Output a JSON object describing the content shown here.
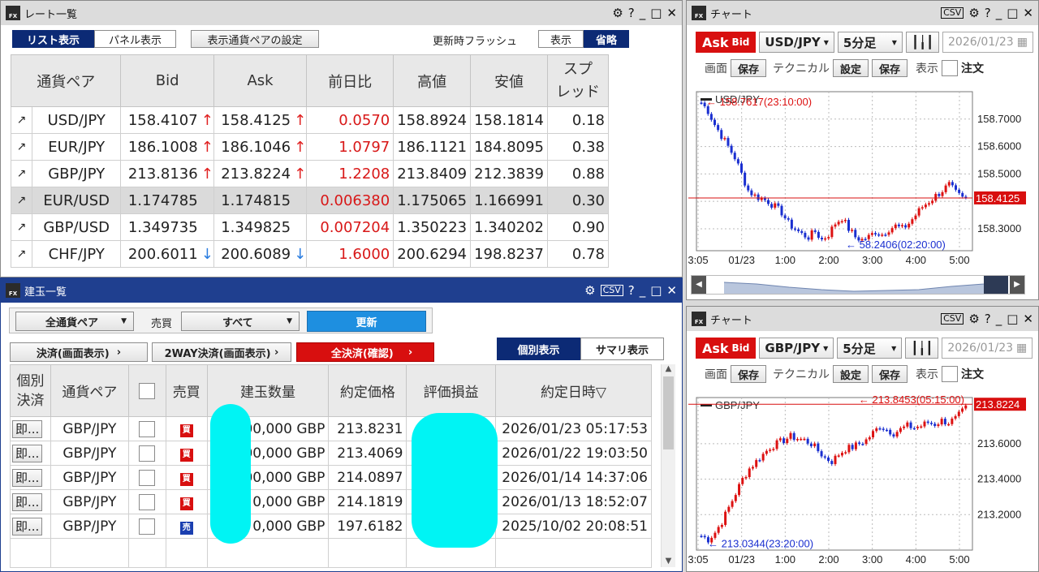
{
  "rate_window": {
    "title": "レート一覧",
    "tab_list": "リスト表示",
    "tab_panel": "パネル表示",
    "pair_settings": "表示通貨ペアの設定",
    "flash_label": "更新時フラッシュ",
    "flash_show": "表示",
    "flash_omit": "省略",
    "headers": {
      "pair": "通貨ペア",
      "bid": "Bid",
      "ask": "Ask",
      "change": "前日比",
      "high": "高値",
      "low": "安値",
      "spread1": "スプ",
      "spread2": "レッド"
    },
    "rows": [
      {
        "pair": "USD/JPY",
        "bid": "158.4107",
        "bid_dir": "up",
        "ask": "158.4125",
        "ask_dir": "up",
        "change": "0.0570",
        "high": "158.8924",
        "low": "158.1814",
        "spread": "0.18"
      },
      {
        "pair": "EUR/JPY",
        "bid": "186.1008",
        "bid_dir": "up",
        "ask": "186.1046",
        "ask_dir": "up",
        "change": "1.0797",
        "high": "186.1121",
        "low": "184.8095",
        "spread": "0.38"
      },
      {
        "pair": "GBP/JPY",
        "bid": "213.8136",
        "bid_dir": "up",
        "ask": "213.8224",
        "ask_dir": "up",
        "change": "1.2208",
        "high": "213.8409",
        "low": "212.3839",
        "spread": "0.88"
      },
      {
        "pair": "EUR/USD",
        "bid": "1.174785",
        "bid_dir": "",
        "ask": "1.174815",
        "ask_dir": "",
        "change": "0.006380",
        "high": "1.175065",
        "low": "1.166991",
        "spread": "0.30"
      },
      {
        "pair": "GBP/USD",
        "bid": "1.349735",
        "bid_dir": "",
        "ask": "1.349825",
        "ask_dir": "",
        "change": "0.007204",
        "high": "1.350223",
        "low": "1.340202",
        "spread": "0.90"
      },
      {
        "pair": "CHF/JPY",
        "bid": "200.6011",
        "bid_dir": "down",
        "ask": "200.6089",
        "ask_dir": "down",
        "change": "1.6000",
        "high": "200.6294",
        "low": "198.8237",
        "spread": "0.78"
      }
    ]
  },
  "position_window": {
    "title": "建玉一覧",
    "filter_pair": "全通貨ペア",
    "side_label": "売買",
    "filter_side": "すべて",
    "refresh": "更新",
    "settle_screen": "決済(画面表示)",
    "settle_2way": "2WAY決済(画面表示)",
    "settle_all": "全決済(確認)",
    "view_individual": "個別表示",
    "view_summary": "サマリ表示",
    "headers": {
      "ind1": "個別",
      "ind2": "決済",
      "pair": "通貨ペア",
      "side": "売買",
      "qty": "建玉数量",
      "price": "約定価格",
      "pl": "評価損益",
      "datetime": "約定日時▽"
    },
    "rows": [
      {
        "btn": "即...",
        "pair": "GBP/JPY",
        "side": "買",
        "side_color": "#d80f0f",
        "qty": "00,000 GBP",
        "price": "213.8231",
        "datetime": "2026/01/23 05:17:53"
      },
      {
        "btn": "即...",
        "pair": "GBP/JPY",
        "side": "買",
        "side_color": "#d80f0f",
        "qty": "00,000 GBP",
        "price": "213.4069",
        "datetime": "2026/01/22 19:03:50"
      },
      {
        "btn": "即...",
        "pair": "GBP/JPY",
        "side": "買",
        "side_color": "#d80f0f",
        "qty": "00,000 GBP",
        "price": "214.0897",
        "datetime": "2026/01/14 14:37:06"
      },
      {
        "btn": "即...",
        "pair": "GBP/JPY",
        "side": "買",
        "side_color": "#d80f0f",
        "qty": "0,000 GBP",
        "price": "214.1819",
        "datetime": "2026/01/13 18:52:07"
      },
      {
        "btn": "即...",
        "pair": "GBP/JPY",
        "side": "売",
        "side_color": "#1a3fb0",
        "qty": "0,000 GBP",
        "price": "197.6182",
        "datetime": "2025/10/02 20:08:51"
      }
    ]
  },
  "chart_windows": [
    {
      "title": "チャート",
      "ask": "Ask",
      "bid": "Bid",
      "pair": "USD/JPY",
      "timeframe": "5分足",
      "date": "2026/01/23",
      "row2": {
        "screen": "画面",
        "save": "保存",
        "technical": "テクニカル",
        "settings": "設定",
        "save2": "保存",
        "display": "表示",
        "order": "注文"
      },
      "chart_data": {
        "type": "candlestick",
        "series_name": "USD/JPY",
        "x_ticks": [
          "3:05",
          "01/23",
          "1:00",
          "2:00",
          "3:00",
          "4:00",
          "5:00"
        ],
        "y_ticks": [
          158.7,
          158.6,
          158.5,
          158.4,
          158.3
        ],
        "y_tick_labels": [
          "158.7000",
          "158.6000",
          "158.5000",
          "158.4000",
          "158.3000"
        ],
        "ylim": [
          158.22,
          158.8
        ],
        "current_price": "158.4125",
        "high_annotation": "158.7617(23:10:00)",
        "low_annotation": "58.2406(02:20:00)",
        "high_value": 158.7617,
        "low_value": 158.2406,
        "close_path": [
          158.76,
          158.73,
          158.68,
          158.64,
          158.6,
          158.56,
          158.5,
          158.44,
          158.42,
          158.41,
          158.4,
          158.38,
          158.36,
          158.32,
          158.3,
          158.28,
          158.27,
          158.29,
          158.26,
          158.28,
          158.32,
          158.34,
          158.3,
          158.27,
          158.26,
          158.27,
          158.29,
          158.28,
          158.3,
          158.31,
          158.3,
          158.32,
          158.35,
          158.38,
          158.4,
          158.42,
          158.44,
          158.46,
          158.43,
          158.41,
          158.41
        ]
      }
    },
    {
      "title": "チャート",
      "ask": "Ask",
      "bid": "Bid",
      "pair": "GBP/JPY",
      "timeframe": "5分足",
      "date": "2026/01/23",
      "row2": {
        "screen": "画面",
        "save": "保存",
        "technical": "テクニカル",
        "settings": "設定",
        "save2": "保存",
        "display": "表示",
        "order": "注文"
      },
      "chart_data": {
        "type": "candlestick",
        "series_name": "GBP/JPY",
        "x_ticks": [
          "3:05",
          "01/23",
          "1:00",
          "2:00",
          "3:00",
          "4:00",
          "5:00"
        ],
        "y_ticks": [
          213.6,
          213.4,
          213.2
        ],
        "y_tick_labels": [
          "213.6000",
          "213.4000",
          "213.2000"
        ],
        "ylim": [
          213.0,
          213.86
        ],
        "current_price": "213.8224",
        "high_annotation": "213.8453(05:15:00)",
        "low_annotation": "213.0344(23:20:00)",
        "high_value": 213.8453,
        "low_value": 213.0344,
        "close_path": [
          213.08,
          213.06,
          213.1,
          213.16,
          213.24,
          213.32,
          213.4,
          213.46,
          213.5,
          213.54,
          213.58,
          213.6,
          213.62,
          213.64,
          213.63,
          213.62,
          213.6,
          213.56,
          213.52,
          213.5,
          213.54,
          213.57,
          213.58,
          213.6,
          213.62,
          213.66,
          213.7,
          213.68,
          213.66,
          213.68,
          213.7,
          213.69,
          213.7,
          213.72,
          213.71,
          213.73,
          213.72,
          213.74,
          213.78,
          213.82
        ]
      }
    }
  ],
  "colors": {
    "accent_red": "#d80f0f",
    "navy": "#0c2a75",
    "blue_btn": "#1e8fe0",
    "up": "#d81818",
    "down": "#1a2fd0",
    "mask": "#00f4f4"
  }
}
